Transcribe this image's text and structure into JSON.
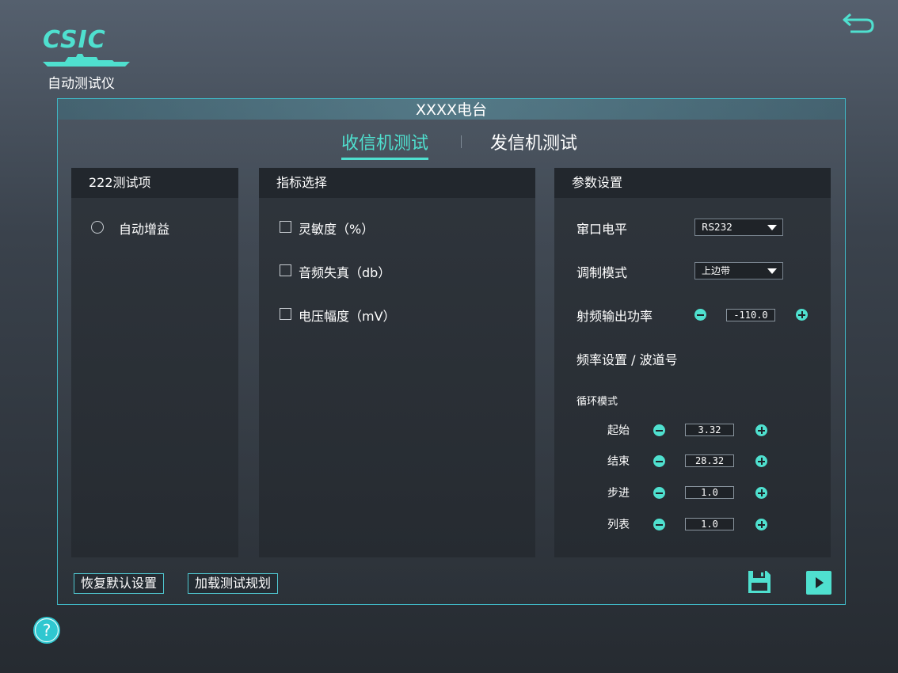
{
  "header": {
    "logo_text": "CSIC",
    "app_title": "自动测试仪"
  },
  "window": {
    "title": "XXXX电台"
  },
  "tabs": [
    {
      "label": "收信机测试",
      "active": true
    },
    {
      "label": "发信机测试",
      "active": false
    }
  ],
  "panels": {
    "test_items": {
      "title": "222测试项",
      "items": [
        {
          "label": "自动增益",
          "selected": false
        }
      ]
    },
    "indicators": {
      "title": "指标选择",
      "items": [
        {
          "label": "灵敏度（%）",
          "checked": false
        },
        {
          "label": "音频失真（db）",
          "checked": false
        },
        {
          "label": "电压幅度（mV）",
          "checked": false
        }
      ]
    },
    "params": {
      "title": "参数设置",
      "port_level_label": "窜口电平",
      "port_level_value": "RS232",
      "modulation_label": "调制模式",
      "modulation_value": "上边带",
      "rf_power_label": "射频输出功率",
      "rf_power_value": "-110.0",
      "freq_label": "频率设置 / 波道号",
      "cycle_label": "循环模式",
      "cycle_rows": [
        {
          "label": "起始",
          "value": "3.32"
        },
        {
          "label": "结束",
          "value": "28.32"
        },
        {
          "label": "步进",
          "value": "1.0"
        },
        {
          "label": "列表",
          "value": "1.0"
        }
      ]
    }
  },
  "footer": {
    "restore_defaults": "恢复默认设置",
    "load_plan": "加载测试规划"
  },
  "colors": {
    "accent": "#4fe0cf",
    "frame_border": "#3fb6c4"
  }
}
